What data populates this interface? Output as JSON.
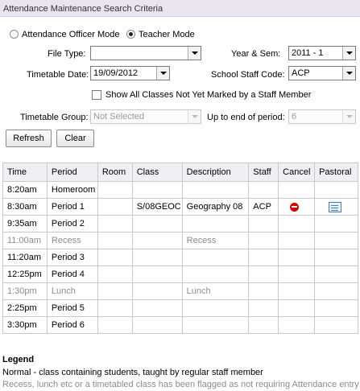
{
  "title": "Attendance Maintenance Search Criteria",
  "mode": {
    "options": [
      "Attendance Officer Mode",
      "Teacher Mode"
    ],
    "selected": "Teacher Mode"
  },
  "form": {
    "file_type_label": "File Type:",
    "file_type_value": "",
    "year_sem_label": "Year & Sem:",
    "year_sem_value": "2011 - 1",
    "timetable_date_label": "Timetable Date:",
    "timetable_date_value": "19/09/2012",
    "school_staff_code_label": "School Staff Code:",
    "school_staff_code_value": "ACP",
    "show_all_label": "Show All Classes Not Yet Marked by a Staff Member",
    "show_all_checked": false,
    "timetable_group_label": "Timetable Group:",
    "timetable_group_value": "Not Selected",
    "up_to_period_label": "Up to end of period:",
    "up_to_period_value": "6"
  },
  "buttons": {
    "refresh": "Refresh",
    "clear": "Clear"
  },
  "table": {
    "columns": [
      "Time",
      "Period",
      "Room",
      "Class",
      "Description",
      "Staff",
      "Cancel",
      "Pastoral"
    ],
    "rows": [
      {
        "time": "8:20am",
        "period": "Homeroom",
        "room": "",
        "class": "",
        "description": "",
        "staff": "",
        "cancel": false,
        "pastoral": false,
        "flagged": false
      },
      {
        "time": "8:30am",
        "period": "Period 1",
        "room": "",
        "class": "S/08GEOC",
        "description": "Geography 08",
        "staff": "ACP",
        "cancel": true,
        "pastoral": true,
        "flagged": false
      },
      {
        "time": "9:35am",
        "period": "Period 2",
        "room": "",
        "class": "",
        "description": "",
        "staff": "",
        "cancel": false,
        "pastoral": false,
        "flagged": false
      },
      {
        "time": "11:00am",
        "period": "Recess",
        "room": "",
        "class": "",
        "description": "Recess",
        "staff": "",
        "cancel": false,
        "pastoral": false,
        "flagged": true
      },
      {
        "time": "11:20am",
        "period": "Period 3",
        "room": "",
        "class": "",
        "description": "",
        "staff": "",
        "cancel": false,
        "pastoral": false,
        "flagged": false
      },
      {
        "time": "12:25pm",
        "period": "Period 4",
        "room": "",
        "class": "",
        "description": "",
        "staff": "",
        "cancel": false,
        "pastoral": false,
        "flagged": false
      },
      {
        "time": "1:30pm",
        "period": "Lunch",
        "room": "",
        "class": "",
        "description": "Lunch",
        "staff": "",
        "cancel": false,
        "pastoral": false,
        "flagged": true
      },
      {
        "time": "2:25pm",
        "period": "Period 5",
        "room": "",
        "class": "",
        "description": "",
        "staff": "",
        "cancel": false,
        "pastoral": false,
        "flagged": false
      },
      {
        "time": "3:30pm",
        "period": "Period 6",
        "room": "",
        "class": "",
        "description": "",
        "staff": "",
        "cancel": false,
        "pastoral": false,
        "flagged": false
      }
    ]
  },
  "icons": {
    "cancel": "cancel-icon",
    "pastoral": "pastoral-icon"
  },
  "legend": {
    "title": "Legend",
    "normal": "Normal - class containing students, taught by regular staff member",
    "flagged": "Recess, lunch etc or a timetabled class has been flagged as not requiring Attendance entry"
  },
  "colors": {
    "header_bg": "#e9e4ee",
    "flagged_text": "#8c8c8c",
    "cancel_red": "#d40000",
    "pastoral_blue": "#3a7bbf"
  }
}
